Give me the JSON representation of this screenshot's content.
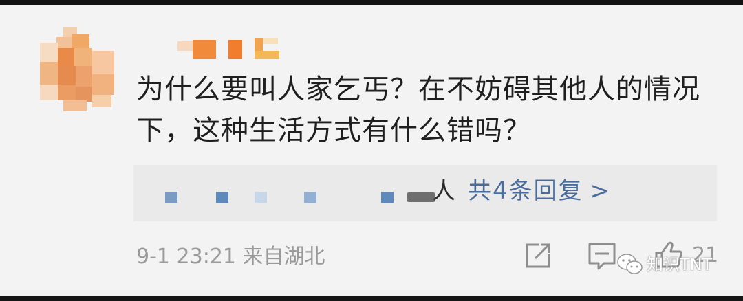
{
  "comment": {
    "text": "为什么要叫人家乞丐？在不妨碍其他人的情况下，这种生活方式有什么错吗？"
  },
  "replies": {
    "trailing_text": "人",
    "count_label": "共4条回复",
    "chevron": ">"
  },
  "footer": {
    "time_location": "9-1 23:21 来自湖北",
    "like_count": "21"
  },
  "icons": {
    "share": "share-icon",
    "comment": "comment-icon",
    "like": "thumbs-up-icon",
    "watermark": "wechat-logo-icon"
  },
  "watermark": {
    "text": "知识TNT"
  },
  "colors": {
    "background": "#f3f3f3",
    "text": "#1f1f1f",
    "link_blue": "#4b6d9b",
    "meta_gray": "#9a9a9a",
    "reply_box": "#eaeaea"
  }
}
